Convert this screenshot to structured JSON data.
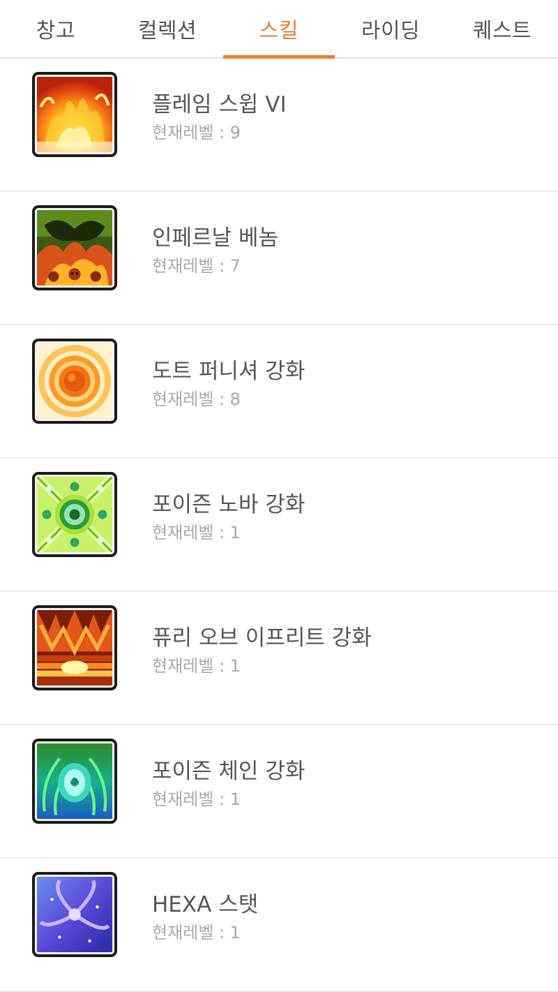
{
  "tabs": [
    {
      "label": "창고",
      "active": false
    },
    {
      "label": "컬렉션",
      "active": false
    },
    {
      "label": "스킬",
      "active": true
    },
    {
      "label": "라이딩",
      "active": false
    },
    {
      "label": "퀘스트",
      "active": false
    }
  ],
  "accent_color": "#e8822e",
  "skills": [
    {
      "name": "플레임 스윕 VI",
      "level_text": "현재레벨 : 9",
      "icon": "flame-sweep-icon"
    },
    {
      "name": "인페르날 베놈",
      "level_text": "현재레벨 : 7",
      "icon": "infernal-venom-icon"
    },
    {
      "name": "도트 퍼니셔 강화",
      "level_text": "현재레벨 : 8",
      "icon": "dot-punisher-icon"
    },
    {
      "name": "포이즌 노바 강화",
      "level_text": "현재레벨 : 1",
      "icon": "poison-nova-icon"
    },
    {
      "name": "퓨리 오브 이프리트 강화",
      "level_text": "현재레벨 : 1",
      "icon": "fury-of-ifrit-icon"
    },
    {
      "name": "포이즌 체인 강화",
      "level_text": "현재레벨 : 1",
      "icon": "poison-chain-icon"
    },
    {
      "name": "HEXA 스탯",
      "level_text": "현재레벨 : 1",
      "icon": "hexa-stat-icon"
    }
  ]
}
